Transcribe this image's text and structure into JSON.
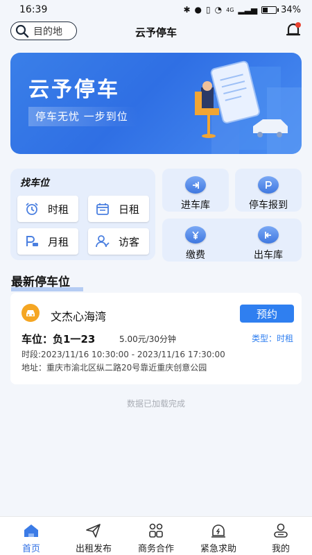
{
  "status_bar": {
    "time": "16:39",
    "battery": "34%",
    "battery_level": 0.34,
    "network": "4G"
  },
  "header": {
    "search_placeholder": "目的地",
    "title": "云予停车"
  },
  "banner": {
    "title": "云予停车",
    "subtitle": "停车无忧 一步到位"
  },
  "find_spot": {
    "title": "找车位",
    "items": [
      {
        "label": "时租",
        "icon": "alarm-clock-icon"
      },
      {
        "label": "日租",
        "icon": "calendar-icon"
      },
      {
        "label": "月租",
        "icon": "monthly-parking-icon"
      },
      {
        "label": "访客",
        "icon": "visitor-icon"
      }
    ]
  },
  "quick_actions": [
    {
      "label": "进车库",
      "icon": "enter-garage-icon"
    },
    {
      "label": "停车报到",
      "icon": "parking-checkin-icon"
    },
    {
      "label": "缴费",
      "icon": "yuan-pay-icon"
    },
    {
      "label": "出车库",
      "icon": "exit-garage-icon"
    }
  ],
  "section": {
    "title": "最新停车位"
  },
  "listing": {
    "name": "文杰心海湾",
    "reserve_label": "预约",
    "space": "车位：负1一23",
    "price": "5.00元/30分钟",
    "type": "类型：时租",
    "time": "时段:2023/11/16 10:30:00 - 2023/11/16 17:30:00",
    "address": "地址：重庆市渝北区纵二路20号靠近重庆创意公园"
  },
  "load_status": "数据已加载完成",
  "tabs": [
    {
      "label": "首页",
      "active": true
    },
    {
      "label": "出租发布",
      "active": false
    },
    {
      "label": "商务合作",
      "active": false
    },
    {
      "label": "紧急求助",
      "active": false
    },
    {
      "label": "我的",
      "active": false
    }
  ],
  "colors": {
    "primary": "#2f7ff0",
    "tile_bg": "#e6eefc",
    "page_bg": "#f3f6fb",
    "accent_orange": "#f5a623"
  }
}
